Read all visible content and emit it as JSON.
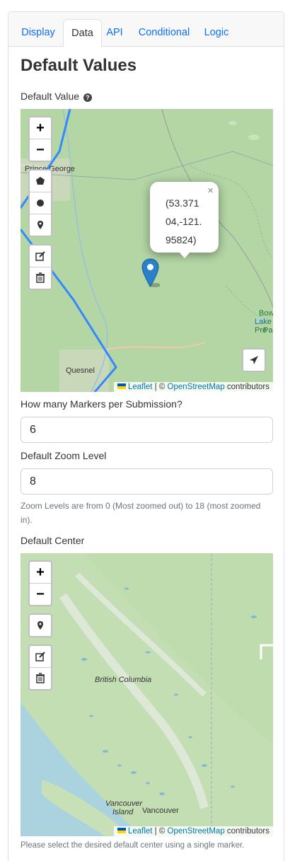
{
  "tabs": [
    {
      "label": "Display",
      "active": false
    },
    {
      "label": "Data",
      "active": true
    },
    {
      "label": "API",
      "active": false
    },
    {
      "label": "Conditional",
      "active": false
    },
    {
      "label": "Logic",
      "active": false
    }
  ],
  "section_title": "Default Values",
  "default_value": {
    "label": "Default Value",
    "help_icon": "question-circle-icon",
    "map": {
      "place_labels": [
        "Prince George",
        "Quesnel",
        "Bowr",
        "Lake Pro",
        "Par"
      ],
      "popup_text": "(53.37104,-121.95824)",
      "controls": {
        "zoom_in": "+",
        "zoom_out": "−"
      },
      "icons": [
        "polygon-icon",
        "circle-icon",
        "marker-icon",
        "edit-icon",
        "trash-icon",
        "locate-icon",
        "marker-pin-icon",
        "close-icon"
      ]
    }
  },
  "markers_per_submission": {
    "label": "How many Markers per Submission?",
    "value": "6"
  },
  "zoom_level": {
    "label": "Default Zoom Level",
    "value": "8",
    "hint": "Zoom Levels are from 0 (Most zoomed out) to 18 (most zoomed in)."
  },
  "default_center": {
    "label": "Default Center",
    "map": {
      "place_labels": [
        "British Columbia",
        "Vancouver",
        "Island",
        "Vancouver"
      ],
      "controls": {
        "zoom_in": "+",
        "zoom_out": "−"
      },
      "icons": [
        "marker-icon",
        "edit-icon",
        "trash-icon"
      ]
    },
    "hint": "Please select the desired default center using a single marker."
  },
  "attribution": {
    "leaflet": "Leaflet",
    "sep": " | © ",
    "osm": "OpenStreetMap",
    "rest": " contributors"
  },
  "colors": {
    "link": "#0d6efd",
    "map_green": "#b6d8a7",
    "region_border": "#3388ff",
    "marker": "#2a81cb"
  }
}
